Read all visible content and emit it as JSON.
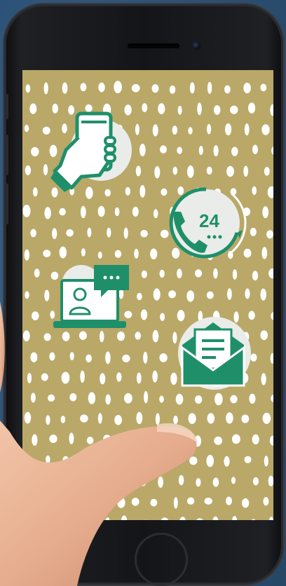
{
  "scene": {
    "background_color": "#30567d",
    "screen_color": "#b9a868",
    "dot_color": "#ffffff",
    "icon_color": "#1f8f6a",
    "icon_fill_light": "#e9ece9"
  },
  "icons": [
    {
      "name": "hand-holding-phone-icon"
    },
    {
      "name": "phone-24-hour-icon",
      "label": "24"
    },
    {
      "name": "video-chat-laptop-icon"
    },
    {
      "name": "open-envelope-mail-icon"
    }
  ],
  "phone_support": {
    "hours_label": "24"
  }
}
